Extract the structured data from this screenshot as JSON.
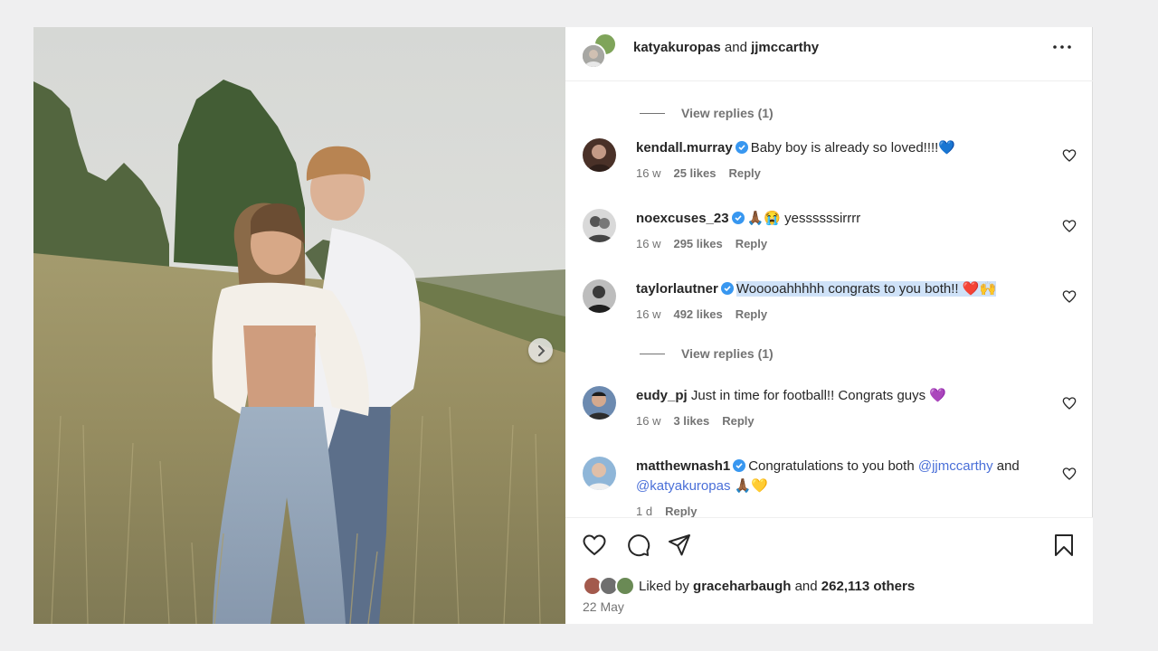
{
  "header": {
    "user1": "katyakuropas",
    "connector": "and",
    "user2": "jjmccarthy",
    "more_icon": "more-horizontal-icon"
  },
  "view_replies_1": "View replies (1)",
  "view_replies_2": "View replies (1)",
  "comments": [
    {
      "user": "kendall.murray",
      "verified": true,
      "text": "Baby boy is already so loved!!!!💙",
      "time": "16 w",
      "likes": "25 likes",
      "reply": "Reply"
    },
    {
      "user": "noexcuses_23",
      "verified": true,
      "text": "🙏🏾😭 yessssssirrrr",
      "time": "16 w",
      "likes": "295 likes",
      "reply": "Reply"
    },
    {
      "user": "taylorlautner",
      "verified": true,
      "text": "Wooooahhhhh congrats to you both!! ❤️🙌",
      "time": "16 w",
      "likes": "492 likes",
      "reply": "Reply"
    },
    {
      "user": "eudy_pj",
      "verified": false,
      "text": "Just in time for football!! Congrats guys 💜",
      "time": "16 w",
      "likes": "3 likes",
      "reply": "Reply"
    },
    {
      "user": "matthewnash1",
      "verified": true,
      "text_1": "Congratulations to you both",
      "mention_1": "@jjmccarthy",
      "text_2": "and",
      "mention_2": "@katyakuropas",
      "text_3": "🙏🏾💛",
      "time": "1 d",
      "reply": "Reply"
    }
  ],
  "actions": {
    "like_icon": "heart-icon",
    "comment_icon": "comment-icon",
    "share_icon": "send-icon",
    "save_icon": "bookmark-icon"
  },
  "liked_by": {
    "prefix": "Liked by",
    "user": "graceharbaugh",
    "connector": "and",
    "others": "262,113 others"
  },
  "date": "22 May",
  "colors": {
    "verified": "#3897f0",
    "mention": "#4a6fd8",
    "highlight": "#cfe2f8",
    "muted": "#737373"
  }
}
